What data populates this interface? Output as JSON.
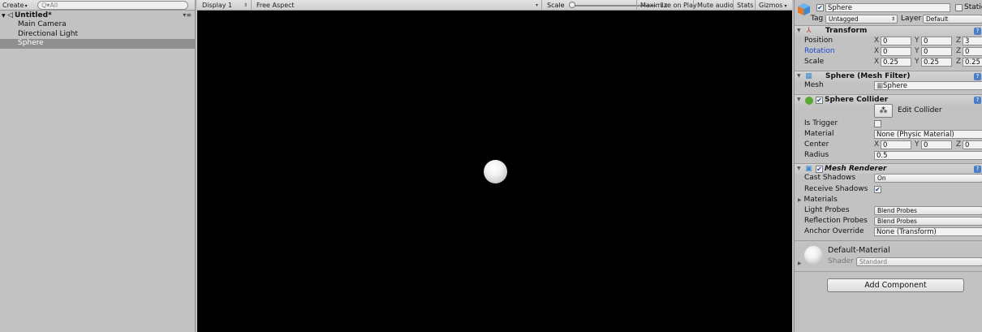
{
  "hierarchy": {
    "create_label": "Create",
    "create_caret": "▾",
    "search_placeholder": "Q▾All",
    "scene_name": "Untitled*",
    "scene_menu": "▾≡",
    "items": [
      "Main Camera",
      "Directional Light",
      "Sphere"
    ],
    "selected_item": "Sphere"
  },
  "game_toolbar": {
    "display": "Display 1",
    "aspect": "Free Aspect",
    "scale_label": "Scale",
    "scale_value": "1x",
    "scale_fraction": 0.0,
    "maximize_on_play": "Maximize on Play",
    "mute_audio": "Mute audio",
    "stats": "Stats",
    "gizmos": "Gizmos"
  },
  "inspector": {
    "object_active": true,
    "object_name": "Sphere",
    "static_label": "Static",
    "tag_label": "Tag",
    "tag_value": "Untagged",
    "layer_label": "Layer",
    "layer_value": "Default",
    "transform": {
      "title": "Transform",
      "position_label": "Position",
      "rotation_label": "Rotation",
      "scale_label": "Scale",
      "position": {
        "x": "0",
        "y": "0",
        "z": "3"
      },
      "rotation": {
        "x": "0",
        "y": "0",
        "z": "0"
      },
      "scale": {
        "x": "0.25",
        "y": "0.25",
        "z": "0.25"
      }
    },
    "mesh_filter": {
      "title": "Sphere (Mesh Filter)",
      "mesh_label": "Mesh",
      "mesh_value": "Sphere"
    },
    "sphere_collider": {
      "title": "Sphere Collider",
      "enabled": true,
      "edit_collider_label": "Edit Collider",
      "is_trigger_label": "Is Trigger",
      "is_trigger": false,
      "material_label": "Material",
      "material_value": "None (Physic Material)",
      "center_label": "Center",
      "center": {
        "x": "0",
        "y": "0",
        "z": "0"
      },
      "radius_label": "Radius",
      "radius_value": "0.5"
    },
    "mesh_renderer": {
      "title": "Mesh Renderer",
      "enabled": true,
      "cast_shadows_label": "Cast Shadows",
      "cast_shadows_value": "On",
      "receive_shadows_label": "Receive Shadows",
      "receive_shadows": true,
      "materials_label": "Materials",
      "light_probes_label": "Light Probes",
      "light_probes_value": "Blend Probes",
      "reflection_probes_label": "Reflection Probes",
      "reflection_probes_value": "Blend Probes",
      "anchor_override_label": "Anchor Override",
      "anchor_override_value": "None (Transform)"
    },
    "material": {
      "name": "Default-Material",
      "shader_label": "Shader",
      "shader_value": "Standard"
    },
    "add_component_label": "Add Component",
    "axis_labels": {
      "x": "X",
      "y": "Y",
      "z": "Z"
    },
    "help_icon_text": "?"
  },
  "colors": {
    "panel_bg": "#c2c2c2",
    "selection_bg": "#8f8f8f",
    "game_bg": "#000000",
    "rotation_label": "#1a4bd3",
    "help_icon": "#4a7fc8"
  }
}
